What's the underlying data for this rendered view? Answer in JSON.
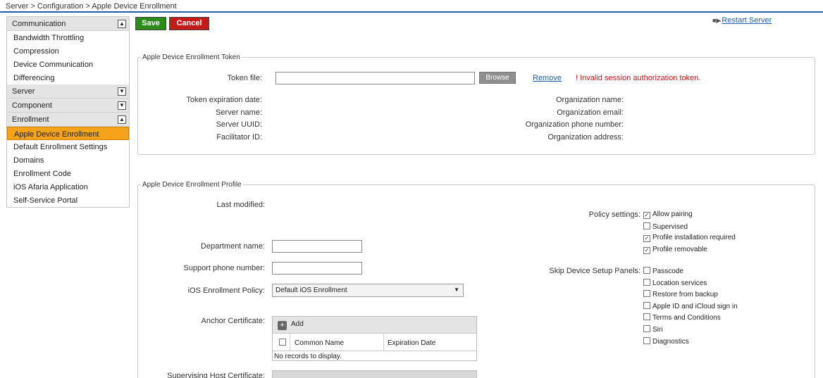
{
  "breadcrumb": "Server > Configuration > Apple Device Enrollment",
  "sidebar": {
    "communication": {
      "header": "Communication",
      "items": [
        "Bandwidth Throttling",
        "Compression",
        "Device Communication",
        "Differencing"
      ]
    },
    "server": {
      "header": "Server"
    },
    "component": {
      "header": "Component"
    },
    "enrollment": {
      "header": "Enrollment",
      "items": [
        "Apple Device Enrollment",
        "Default Enrollment Settings",
        "Domains",
        "Enrollment Code",
        "iOS Afaria Application",
        "Self-Service Portal"
      ],
      "active": "Apple Device Enrollment"
    }
  },
  "toolbar": {
    "save": "Save",
    "cancel": "Cancel",
    "restart": "Restart Server"
  },
  "token": {
    "legend": "Apple Device Enrollment Token",
    "token_file_label": "Token file:",
    "token_file_value": "",
    "browse": "Browse",
    "remove": "Remove",
    "error": "! Invalid session authorization token.",
    "left_labels": [
      "Token expiration date:",
      "Server name:",
      "Server UUID:",
      "Facilitator ID:"
    ],
    "right_labels": [
      "Organization name:",
      "Organization email:",
      "Organization phone number:",
      "Organization address:"
    ]
  },
  "profile": {
    "legend": "Apple Device Enrollment Profile",
    "last_modified_label": "Last modified:",
    "department_label": "Department name:",
    "department_value": "",
    "support_phone_label": "Support phone number:",
    "support_phone_value": "",
    "ios_policy_label": "iOS Enrollment Policy:",
    "ios_policy_value": "Default iOS Enrollment",
    "anchor_label": "Anchor Certificate:",
    "supervising_label": "Supervising Host Certificate:",
    "grid": {
      "add": "Add",
      "col_common": "Common Name",
      "col_expiration": "Expiration Date",
      "empty": "No records to display."
    },
    "policy_settings_label": "Policy settings:",
    "policy_settings": [
      {
        "label": "Allow pairing",
        "checked": true
      },
      {
        "label": "Supervised",
        "checked": false
      },
      {
        "label": "Profile installation required",
        "checked": true
      },
      {
        "label": "Profile removable",
        "checked": true
      }
    ],
    "skip_panels_label": "Skip Device Setup Panels:",
    "skip_panels": [
      {
        "label": "Passcode",
        "checked": false
      },
      {
        "label": "Location services",
        "checked": false
      },
      {
        "label": "Restore from backup",
        "checked": false
      },
      {
        "label": "Apple ID and iCloud sign in",
        "checked": false
      },
      {
        "label": "Terms and Conditions",
        "checked": false
      },
      {
        "label": "Siri",
        "checked": false
      },
      {
        "label": "Diagnostics",
        "checked": false
      }
    ]
  }
}
